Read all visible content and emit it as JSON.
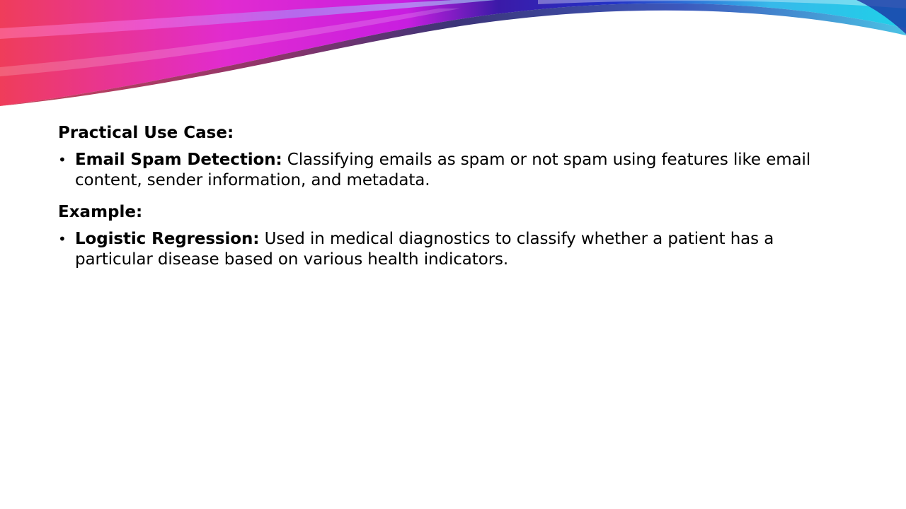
{
  "slide": {
    "colors": {
      "swoosh_red": "#e8384f",
      "swoosh_magenta": "#e020d8",
      "swoosh_navy": "#14147a",
      "swoosh_cyan": "#2ad4ec"
    },
    "sections": [
      {
        "heading": "Practical Use Case:",
        "bullet": {
          "term": "Email Spam Detection:",
          "text": " Classifying emails as spam or not spam using features like email content, sender information, and metadata."
        }
      },
      {
        "heading": "Example:",
        "bullet": {
          "term": "Logistic Regression:",
          "text": " Used in medical diagnostics to classify whether a patient has a particular disease based on various health indicators."
        }
      }
    ],
    "bullet_glyph": "•"
  }
}
